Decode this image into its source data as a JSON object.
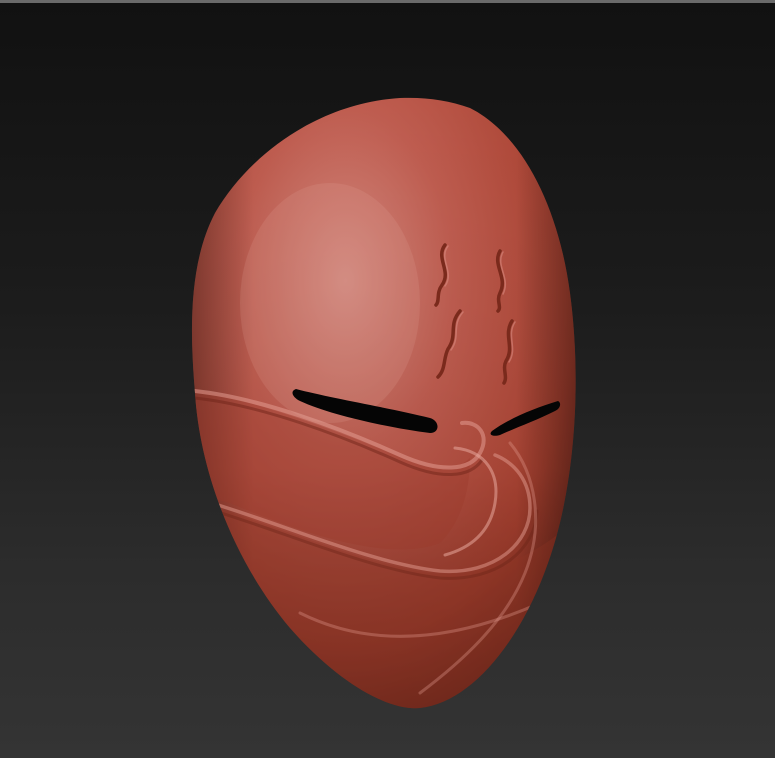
{
  "viewport": {
    "background_top": "#111111",
    "background_bottom": "#343434",
    "border_color": "#6a6a6a"
  },
  "model": {
    "subject": "mask-model",
    "base_color": "#b24a3a",
    "highlight_color": "#cf7a70",
    "shadow_color": "#6e2418",
    "eye_slit_color": "#050505"
  }
}
